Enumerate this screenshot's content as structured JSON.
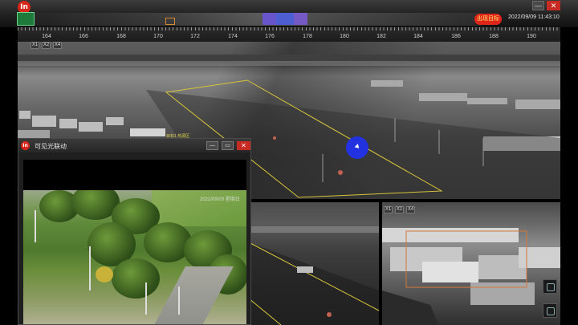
{
  "app": {
    "logo_text": "In",
    "status_button": "出现目标",
    "clock": "2022/09/09 11:43:10",
    "window_controls": {
      "minimize": "—",
      "close": "✕"
    }
  },
  "ruler": {
    "ticks": [
      "164",
      "166",
      "168",
      "170",
      "172",
      "174",
      "176",
      "178",
      "180",
      "182",
      "184",
      "186",
      "188",
      "190"
    ]
  },
  "zoom_buttons": [
    "X1",
    "X2",
    "X4"
  ],
  "main_view": {
    "target_label": "目标1 热源区"
  },
  "visible_window": {
    "title": "可见光联动",
    "osd_text": "2022/09/09 星期日",
    "buttons": {
      "minimize": "—",
      "restore": "▭",
      "close": "✕"
    }
  },
  "sub_view_right": {
    "zoom_buttons": [
      "X1",
      "X2",
      "X4"
    ]
  },
  "colors": {
    "accent_red": "#d8261b",
    "status_red": "#e0251b",
    "overlay_yellow": "#d7c43a",
    "cursor_blue": "#2232e0"
  }
}
